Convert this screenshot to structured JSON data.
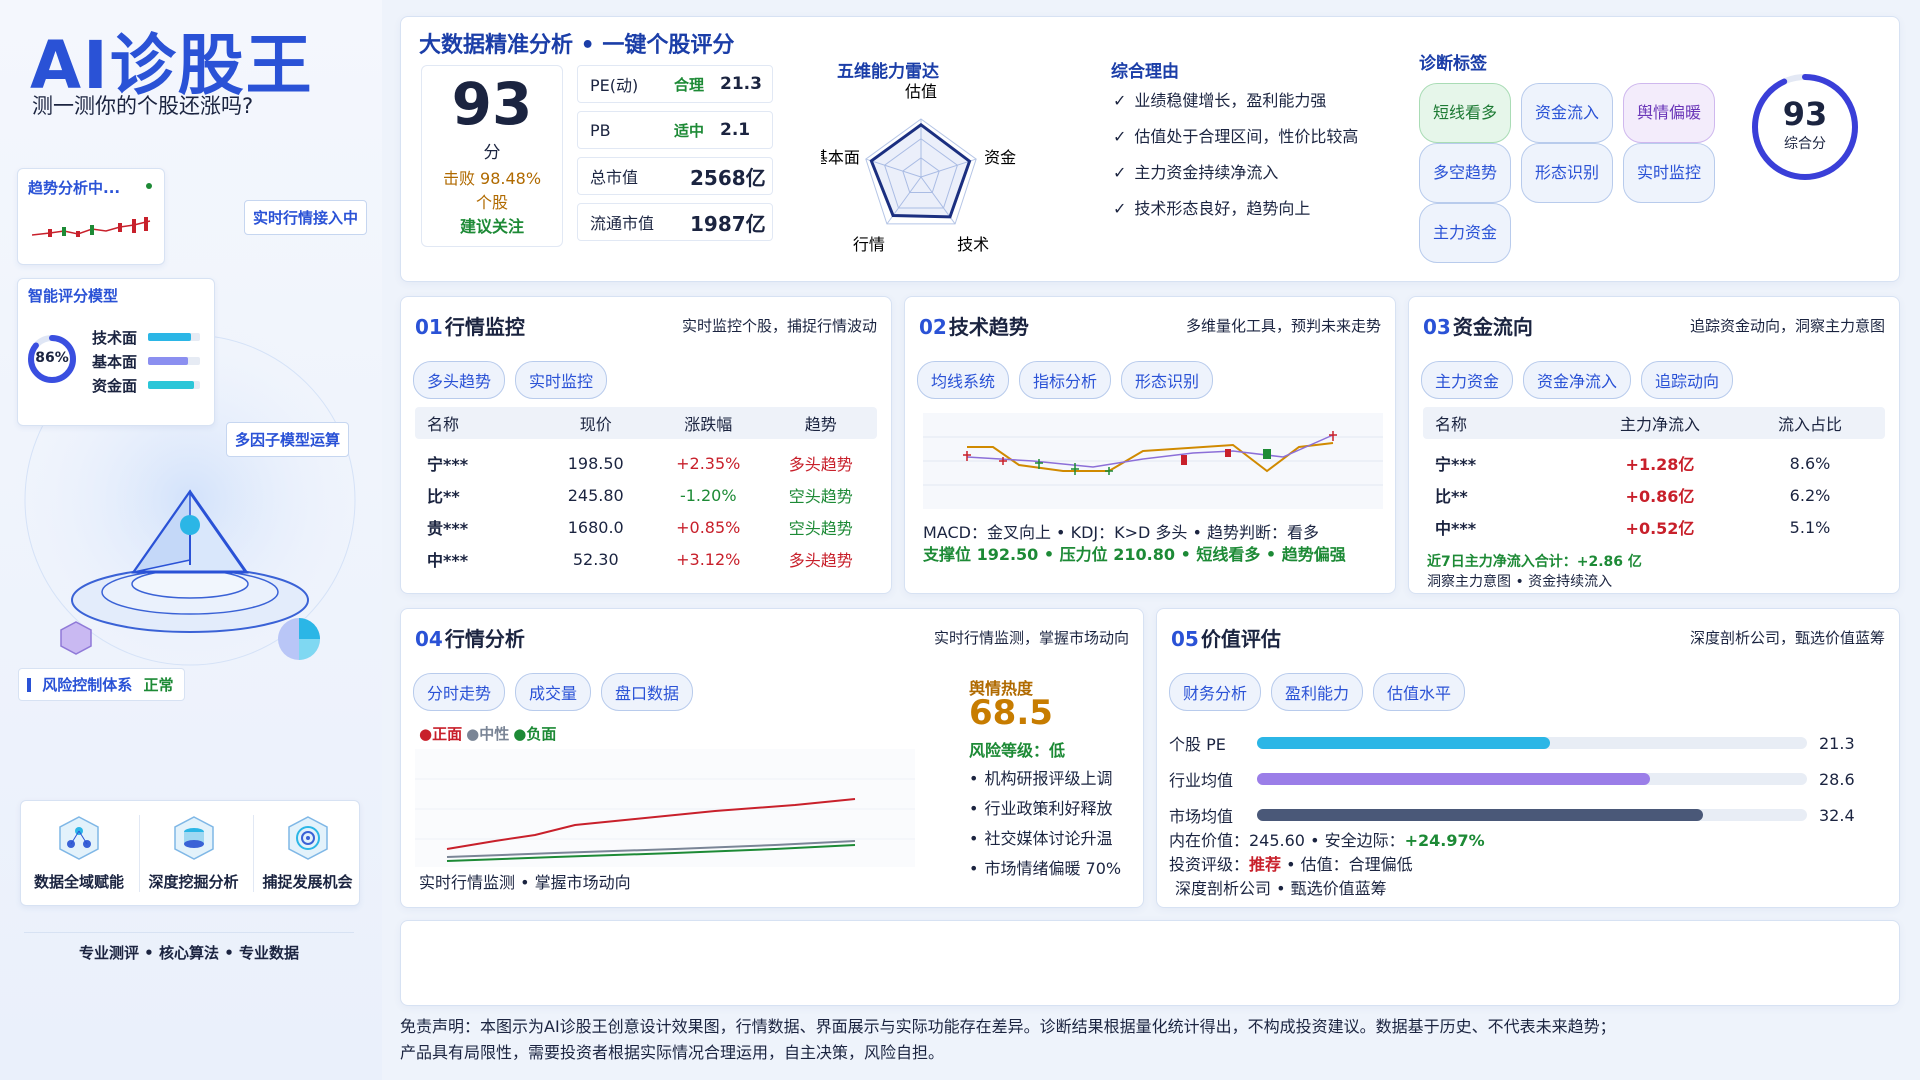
{
  "brand": {
    "title": "AI诊股王",
    "subtitle": "测一测你的个股还涨吗?"
  },
  "left": {
    "trend_card": {
      "title": "趋势分析中..."
    },
    "realtime_tag": "实时行情接入中",
    "model_card": {
      "title": "智能评分模型",
      "ring_value": "86%",
      "ring_pct": 0.86,
      "items": [
        {
          "label": "技术面",
          "level": 0.82,
          "color": "#2bb6e6"
        },
        {
          "label": "基本面",
          "level": 0.76,
          "color": "#8b8ff0"
        },
        {
          "label": "资金面",
          "level": 0.88,
          "color": "#2bc6d8"
        }
      ]
    },
    "multi_factor_tag": "多因子模型运算",
    "risk": {
      "label": "风险控制体系",
      "status": "正常"
    },
    "features": [
      {
        "label": "数据全域赋能",
        "icon": "network-icon"
      },
      {
        "label": "深度挖掘分析",
        "icon": "database-icon"
      },
      {
        "label": "捕捉发展机会",
        "icon": "target-icon"
      }
    ],
    "slogan": "专业测评 • 核心算法 • 专业数据"
  },
  "top": {
    "title": "大数据精准分析 • 一键个股评分",
    "score": {
      "value": "93",
      "unit": "分",
      "beat": "击败 98.48%",
      "beat2": "个股",
      "advice": "建议关注"
    },
    "metrics": [
      {
        "label": "PE(动)",
        "tag": "合理",
        "value": "21.3"
      },
      {
        "label": "PB",
        "tag": "适中",
        "value": "2.1"
      },
      {
        "label": "总市值",
        "tag": "",
        "value": "2568亿"
      },
      {
        "label": "流通市值",
        "tag": "",
        "value": "1987亿"
      }
    ],
    "radar": {
      "title": "五维能力雷达",
      "axes": [
        "估值",
        "资金",
        "技术",
        "行情",
        "基本面"
      ],
      "values": [
        0.9,
        0.88,
        0.85,
        0.82,
        0.9
      ]
    },
    "reasons": {
      "title": "综合理由",
      "items": [
        "业绩稳健增长，盈利能力强",
        "估值处于合理区间，性价比较高",
        "主力资金持续净流入",
        "技术形态良好，趋势向上"
      ]
    },
    "tags": {
      "title": "诊断标签",
      "items": [
        {
          "label": "短线看多",
          "style": "green"
        },
        {
          "label": "资金流入",
          "style": "blue"
        },
        {
          "label": "舆情偏暖",
          "style": "purple"
        },
        {
          "label": "多空趋势",
          "style": "blue"
        },
        {
          "label": "形态识别",
          "style": "blue"
        },
        {
          "label": "实时监控",
          "style": "blue"
        },
        {
          "label": "主力资金",
          "style": "blue"
        }
      ]
    },
    "gauge": {
      "value": "93",
      "label": "综合分",
      "pct": 0.93
    }
  },
  "sec1": {
    "num": "01",
    "title": "行情监控",
    "sub": "实时监控个股，捕捉行情波动",
    "pills": [
      "多头趋势",
      "实时监控"
    ],
    "headers": [
      "名称",
      "现价",
      "涨跌幅",
      "趋势"
    ],
    "rows": [
      {
        "name": "宁***",
        "price": "198.50",
        "chg": "+2.35%",
        "trend": "多头趋势",
        "chg_dir": "up",
        "trend_dir": "up"
      },
      {
        "name": "比**",
        "price": "245.80",
        "chg": "-1.20%",
        "trend": "空头趋势",
        "chg_dir": "dn",
        "trend_dir": "dn"
      },
      {
        "name": "贵***",
        "price": "1680.0",
        "chg": "+0.85%",
        "trend": "空头趋势",
        "chg_dir": "up",
        "trend_dir": "dn"
      },
      {
        "name": "中***",
        "price": "52.30",
        "chg": "+3.12%",
        "trend": "多头趋势",
        "chg_dir": "up",
        "trend_dir": "up"
      }
    ]
  },
  "sec2": {
    "num": "02",
    "title": "技术趋势",
    "sub": "多维量化工具，预判未来走势",
    "pills": [
      "均线系统",
      "指标分析",
      "形态识别"
    ],
    "line1": "MACD：金叉向上 • KDJ：K>D 多头 • 趋势判断：看多",
    "line2": "支撑位 192.50 • 压力位 210.80 • 短线看多 • 趋势偏强"
  },
  "sec3": {
    "num": "03",
    "title": "资金流向",
    "sub": "追踪资金动向，洞察主力意图",
    "pills": [
      "主力资金",
      "资金净流入",
      "追踪动向"
    ],
    "headers": [
      "名称",
      "主力净流入",
      "流入占比"
    ],
    "rows": [
      {
        "name": "宁***",
        "flow": "+1.28亿",
        "pct": "8.6%"
      },
      {
        "name": "比**",
        "flow": "+0.86亿",
        "pct": "6.2%"
      },
      {
        "name": "中***",
        "flow": "+0.52亿",
        "pct": "5.1%"
      }
    ],
    "note1": "近7日主力净流入合计：+2.86 亿",
    "note2": "洞察主力意图 • 资金持续流入"
  },
  "sec4": {
    "num": "04",
    "title": "行情分析",
    "sub": "实时行情监测，掌握市场动向",
    "pills": [
      "分时走势",
      "成交量",
      "盘口数据"
    ],
    "legend": [
      {
        "label": "正面",
        "color": "#c8202b"
      },
      {
        "label": "中性",
        "color": "#7a8596"
      },
      {
        "label": "负面",
        "color": "#1d8a36"
      }
    ],
    "caption": "实时行情监测 • 掌握市场动向",
    "heat": {
      "title": "舆情热度",
      "value": "68.5",
      "risk_label": "风险等级：",
      "risk": "低"
    },
    "bullets": [
      "机构研报评级上调",
      "行业政策利好释放",
      "社交媒体讨论升温",
      "市场情绪偏暖 70%"
    ]
  },
  "sec5": {
    "num": "05",
    "title": "价值评估",
    "sub": "深度剖析公司，甄选价值蓝筹",
    "pills": [
      "财务分析",
      "盈利能力",
      "估值水平"
    ],
    "bars": [
      {
        "label": "个股 PE",
        "value": 21.3,
        "text": "21.3",
        "color": "#2bb6e6"
      },
      {
        "label": "行业均值",
        "value": 28.6,
        "text": "28.6",
        "color": "#9b7ee8"
      },
      {
        "label": "市场均值",
        "value": 32.4,
        "text": "32.4",
        "color": "#4a5878"
      }
    ],
    "bar_max": 40,
    "intrinsic": "内在价值：245.60 • 安全边际：",
    "margin": "+24.97%",
    "rating_label": "投资评级：",
    "rating": "推荐",
    "rating_rest": " • 估值：合理偏低",
    "tagline": "深度剖析公司 • 甄选价值蓝筹"
  },
  "footer": {
    "line1": "免责声明：本图示为AI诊股王创意设计效果图，行情数据、界面展示与实际功能存在差异。诊断结果根据量化统计得出，不构成投资建议。数据基于历史、不代表未来趋势；",
    "line2": "产品具有局限性，需要投资者根据实际情况合理运用，自主决策，风险自担。"
  }
}
